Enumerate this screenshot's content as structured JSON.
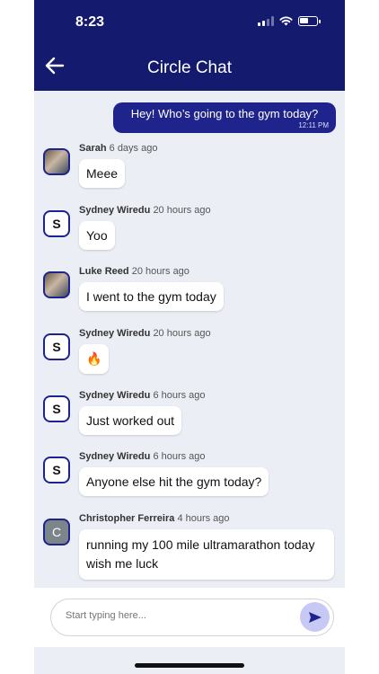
{
  "status_bar": {
    "time": "8:23"
  },
  "header": {
    "title": "Circle Chat"
  },
  "sent_message": {
    "text": "Hey! Who’s going to the gym today?",
    "timestamp": "12:11 PM"
  },
  "messages": [
    {
      "sender": "Sarah",
      "time": "6 days ago",
      "avatar_initial": "",
      "text": "Meee"
    },
    {
      "sender": "Sydney Wiredu",
      "time": "20 hours ago",
      "avatar_initial": "S",
      "text": "Yoo"
    },
    {
      "sender": "Luke Reed",
      "time": "20 hours ago",
      "avatar_initial": "",
      "text": "I went to the gym today"
    },
    {
      "sender": "Sydney Wiredu",
      "time": "20 hours ago",
      "avatar_initial": "S",
      "text": "🔥"
    },
    {
      "sender": "Sydney Wiredu",
      "time": "6 hours ago",
      "avatar_initial": "S",
      "text": "Just worked out"
    },
    {
      "sender": "Sydney Wiredu",
      "time": "6 hours ago",
      "avatar_initial": "S",
      "text": "Anyone else hit the gym today?"
    },
    {
      "sender": "Christopher Ferreira",
      "time": "4 hours ago",
      "avatar_initial": "C",
      "text": "running my 100 mile ultramarathon today wish me luck"
    }
  ],
  "composer": {
    "placeholder": "Start typing here..."
  },
  "colors": {
    "header_bg": "#141a6e",
    "sent_bubble": "#1f238c",
    "chat_bg": "#eceef5",
    "send_button": "#c7c9f4"
  }
}
